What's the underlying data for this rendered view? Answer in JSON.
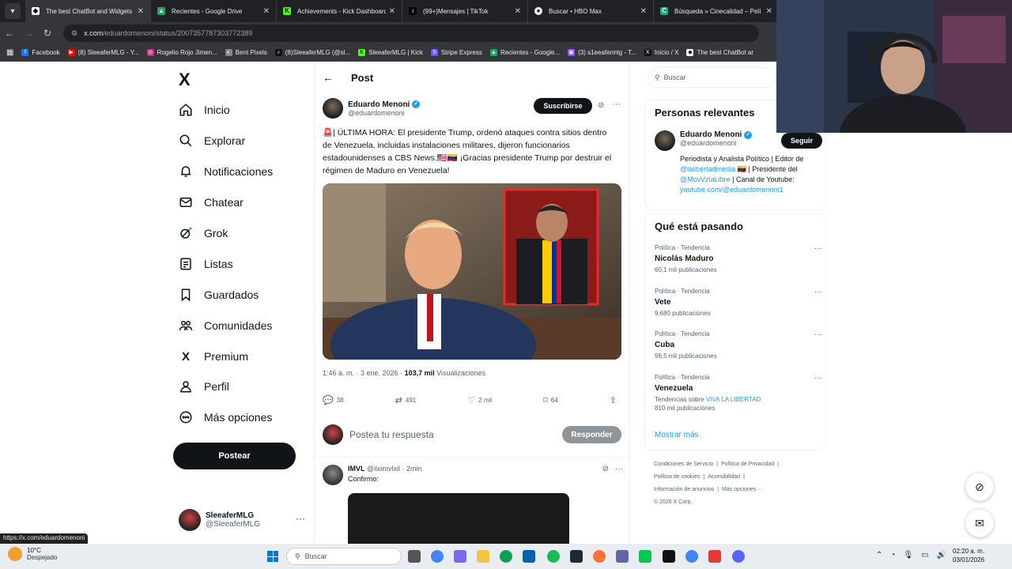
{
  "browser": {
    "tabs": [
      {
        "title": "The best ChatBot and Widgets",
        "icon": "chatbot-favicon",
        "active": true
      },
      {
        "title": "Recientes - Google Drive",
        "icon": "google-drive-favicon",
        "active": false
      },
      {
        "title": "Achievements - Kick Dashboard",
        "icon": "kick-favicon",
        "active": false
      },
      {
        "title": "(99+)Mensajes | TikTok",
        "icon": "tiktok-favicon",
        "active": false
      },
      {
        "title": "Buscar • HBO Max",
        "icon": "hbo-max-favicon",
        "active": false
      },
      {
        "title": "Búsqueda » Cinecalidad – Pelí",
        "icon": "cinecalidad-favicon",
        "active": false
      }
    ],
    "url_host": "x.com",
    "url_path": "/eduardomenoni/status/2007357787303772389",
    "bookmarks": [
      {
        "label": "Facebook",
        "color": "#1877f2"
      },
      {
        "label": "(8) SleeaferMLG - Y...",
        "color": "#ff0000"
      },
      {
        "label": "Rogelio Rojo Jimen...",
        "color": "#c13584"
      },
      {
        "label": "Bent Pixels",
        "color": "#888888"
      },
      {
        "label": "(8)SleeaferMLG (@sl...",
        "color": "#111111"
      },
      {
        "label": "SleeaferMLG | Kick",
        "color": "#53fc18"
      },
      {
        "label": "Stripe Express",
        "color": "#635bff"
      },
      {
        "label": "Recientes - Google...",
        "color": "#1fa463"
      },
      {
        "label": "(3) s1eeafermlg - T...",
        "color": "#9146ff"
      },
      {
        "label": "Inicio / X",
        "color": "#111111"
      },
      {
        "label": "The best ChatBot ar",
        "color": "#ffffff"
      }
    ],
    "status_url": "https://x.com/eduardomenoni"
  },
  "sidebar": {
    "logo": "X",
    "items": [
      {
        "label": "Inicio",
        "icon": "home-icon"
      },
      {
        "label": "Explorar",
        "icon": "search-icon"
      },
      {
        "label": "Notificaciones",
        "icon": "bell-icon"
      },
      {
        "label": "Chatear",
        "icon": "mail-icon"
      },
      {
        "label": "Grok",
        "icon": "grok-icon"
      },
      {
        "label": "Listas",
        "icon": "list-icon"
      },
      {
        "label": "Guardados",
        "icon": "bookmark-icon"
      },
      {
        "label": "Comunidades",
        "icon": "communities-icon"
      },
      {
        "label": "Premium",
        "icon": "x-premium-icon"
      },
      {
        "label": "Perfil",
        "icon": "person-icon"
      },
      {
        "label": "Más opciones",
        "icon": "more-circle-icon"
      }
    ],
    "post_button": "Postear",
    "account": {
      "name": "SleeaferMLG",
      "handle": "@SleeaferMLG"
    }
  },
  "main": {
    "header_title": "Post",
    "author": {
      "name": "Eduardo Menoni",
      "handle": "@eduardomenoni"
    },
    "subscribe_label": "Suscribirse",
    "text": "🚨| ÚLTIMA HORA: El presidente Trump, ordenó ataques contra sitios dentro de Venezuela, incluidas instalaciones militares, dijeron funcionarios estadounidenses a CBS News.🇺🇸🇻🇪 ¡Gracias presidente Trump por destruir el régimen de Maduro en Venezuela!",
    "meta_time": "1:46 a. m. · 3 ene. 2026 · ",
    "meta_views": "103,7 mil",
    "meta_views_label": " Visualizaciones",
    "actions": {
      "replies": "38",
      "reposts": "491",
      "likes": "2 mil",
      "bookmarks": "64"
    },
    "reply_placeholder": "Postea tu respuesta",
    "reply_button": "Responder",
    "reply1": {
      "name": "IMVL",
      "handle": "@ilximvlxil",
      "time": "· 2min",
      "text": "Confirmo:"
    }
  },
  "right": {
    "search_placeholder": "Buscar",
    "relevant_title": "Personas relevantes",
    "relevant_user": {
      "name": "Eduardo Menoni",
      "handle": "@eduardomenoni",
      "follow": "Seguir"
    },
    "bio_1": "Periodista y Analista Político | Editor de ",
    "bio_link1": "@lalibertadmedia",
    "bio_2": " 🇻🇪 | Presidente del ",
    "bio_link2": "@MovVzlaLibre",
    "bio_3": " | Canal de Youtube: ",
    "bio_link3": "youtube.com/@eduardomenoni1",
    "trends_title": "Qué está pasando",
    "trends": [
      {
        "category": "Política · Tendencia",
        "name": "Nicolás Maduro",
        "sub": "60,1 mil publicaciones"
      },
      {
        "category": "Política · Tendencia",
        "name": "Vete",
        "sub": "9.680 publicaciones"
      },
      {
        "category": "Política · Tendencia",
        "name": "Cuba",
        "sub": "96,5 mil publicaciones"
      },
      {
        "category": "Política · Tendencia",
        "name": "Venezuela",
        "sub_prefix": "Tendencias sobre ",
        "sub_link": "VIVA LA LIBERTAD",
        "sub": "810 mil publicaciones"
      }
    ],
    "show_more": "Mostrar más",
    "footer": [
      "Condiciones de Servicio",
      "|",
      "Política de Privacidad",
      "|",
      "Política de cookies",
      "|",
      "Accesibilidad",
      "|",
      "Información de anuncios",
      "|",
      "Más opciones ···",
      "© 2026 X Corp."
    ]
  },
  "taskbar": {
    "temp": "10°C",
    "weather": "Despejado",
    "search": "Buscar",
    "time": "02:20 a. m.",
    "date": "03/01/2026"
  }
}
